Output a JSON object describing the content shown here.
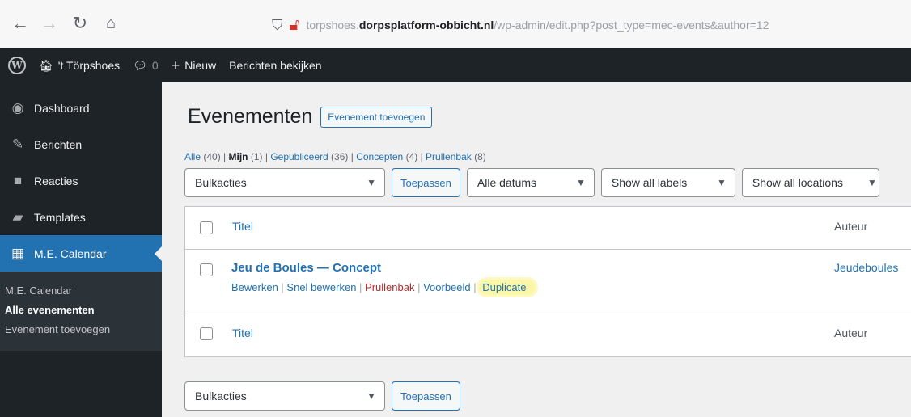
{
  "browser": {
    "url_prefix": "torpshoes.",
    "url_domain": "dorpsplatform-obbicht.nl",
    "url_path": "/wp-admin/edit.php?post_type=mec-events&author=12"
  },
  "adminbar": {
    "site_name": "'t Törpshoes",
    "comments_count": "0",
    "new_label": "Nieuw",
    "view_posts_label": "Berichten bekijken"
  },
  "sidebar": {
    "items": [
      {
        "label": "Dashboard",
        "icon": "dashboard-icon"
      },
      {
        "label": "Berichten",
        "icon": "pin-icon"
      },
      {
        "label": "Reacties",
        "icon": "comment-icon"
      },
      {
        "label": "Templates",
        "icon": "folder-icon"
      },
      {
        "label": "M.E. Calendar",
        "icon": "calendar-icon"
      }
    ],
    "submenu": [
      "M.E. Calendar",
      "Alle evenementen",
      "Evenement toevoegen"
    ]
  },
  "page": {
    "title": "Evenementen",
    "add_button": "Evenement toevoegen"
  },
  "views": {
    "all": "Alle",
    "all_count": "(40)",
    "mine": "Mijn",
    "mine_count": "(1)",
    "published": "Gepubliceerd",
    "published_count": "(36)",
    "drafts": "Concepten",
    "drafts_count": "(4)",
    "trash": "Prullenbak",
    "trash_count": "(8)"
  },
  "filters": {
    "bulk_actions": "Bulkacties",
    "apply": "Toepassen",
    "dates": "Alle datums",
    "labels": "Show all labels",
    "locations": "Show all locations"
  },
  "table": {
    "col_title": "Titel",
    "col_author": "Auteur",
    "row": {
      "title": "Jeu de Boules — Concept",
      "author": "Jeudeboules",
      "actions": {
        "edit": "Bewerken",
        "quick_edit": "Snel bewerken",
        "trash": "Prullenbak",
        "preview": "Voorbeeld",
        "duplicate": "Duplicate"
      }
    }
  },
  "colors": {
    "admin_dark": "#1d2327",
    "accent": "#2271b1",
    "highlight": "#fbf7a8"
  }
}
